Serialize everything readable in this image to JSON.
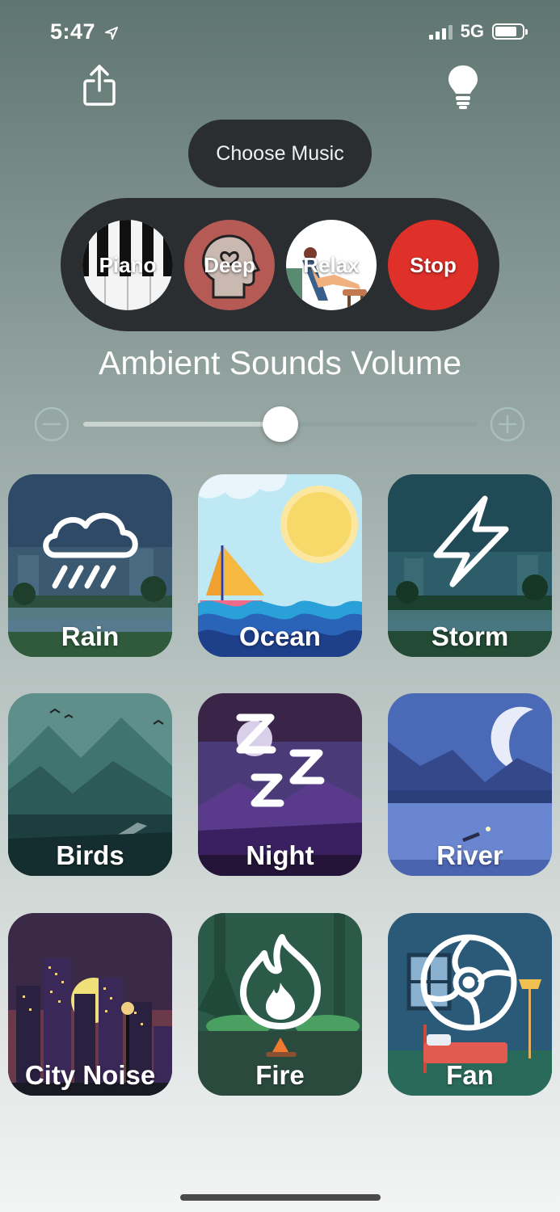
{
  "status": {
    "time": "5:47",
    "network": "5G"
  },
  "colors": {
    "pill_bg": "#2a2e30",
    "stop_red": "#e0302a",
    "deep_red": "#b55a55",
    "accent": "#ffffff"
  },
  "icons": {
    "share": "share-icon",
    "lightbulb": "lightbulb-icon",
    "location": "location-arrow-icon",
    "minus": "minus-circle-icon",
    "plus": "plus-circle-icon"
  },
  "music": {
    "choose_label": "Choose Music",
    "options": [
      {
        "label": "Piano"
      },
      {
        "label": "Deep"
      },
      {
        "label": "Relax"
      },
      {
        "label": "Stop"
      }
    ]
  },
  "volume": {
    "title": "Ambient Sounds Volume",
    "level": 0.5
  },
  "sounds": [
    {
      "label": "Rain"
    },
    {
      "label": "Ocean"
    },
    {
      "label": "Storm"
    },
    {
      "label": "Birds"
    },
    {
      "label": "Night"
    },
    {
      "label": "River"
    },
    {
      "label": "City Noise"
    },
    {
      "label": "Fire"
    },
    {
      "label": "Fan"
    }
  ]
}
